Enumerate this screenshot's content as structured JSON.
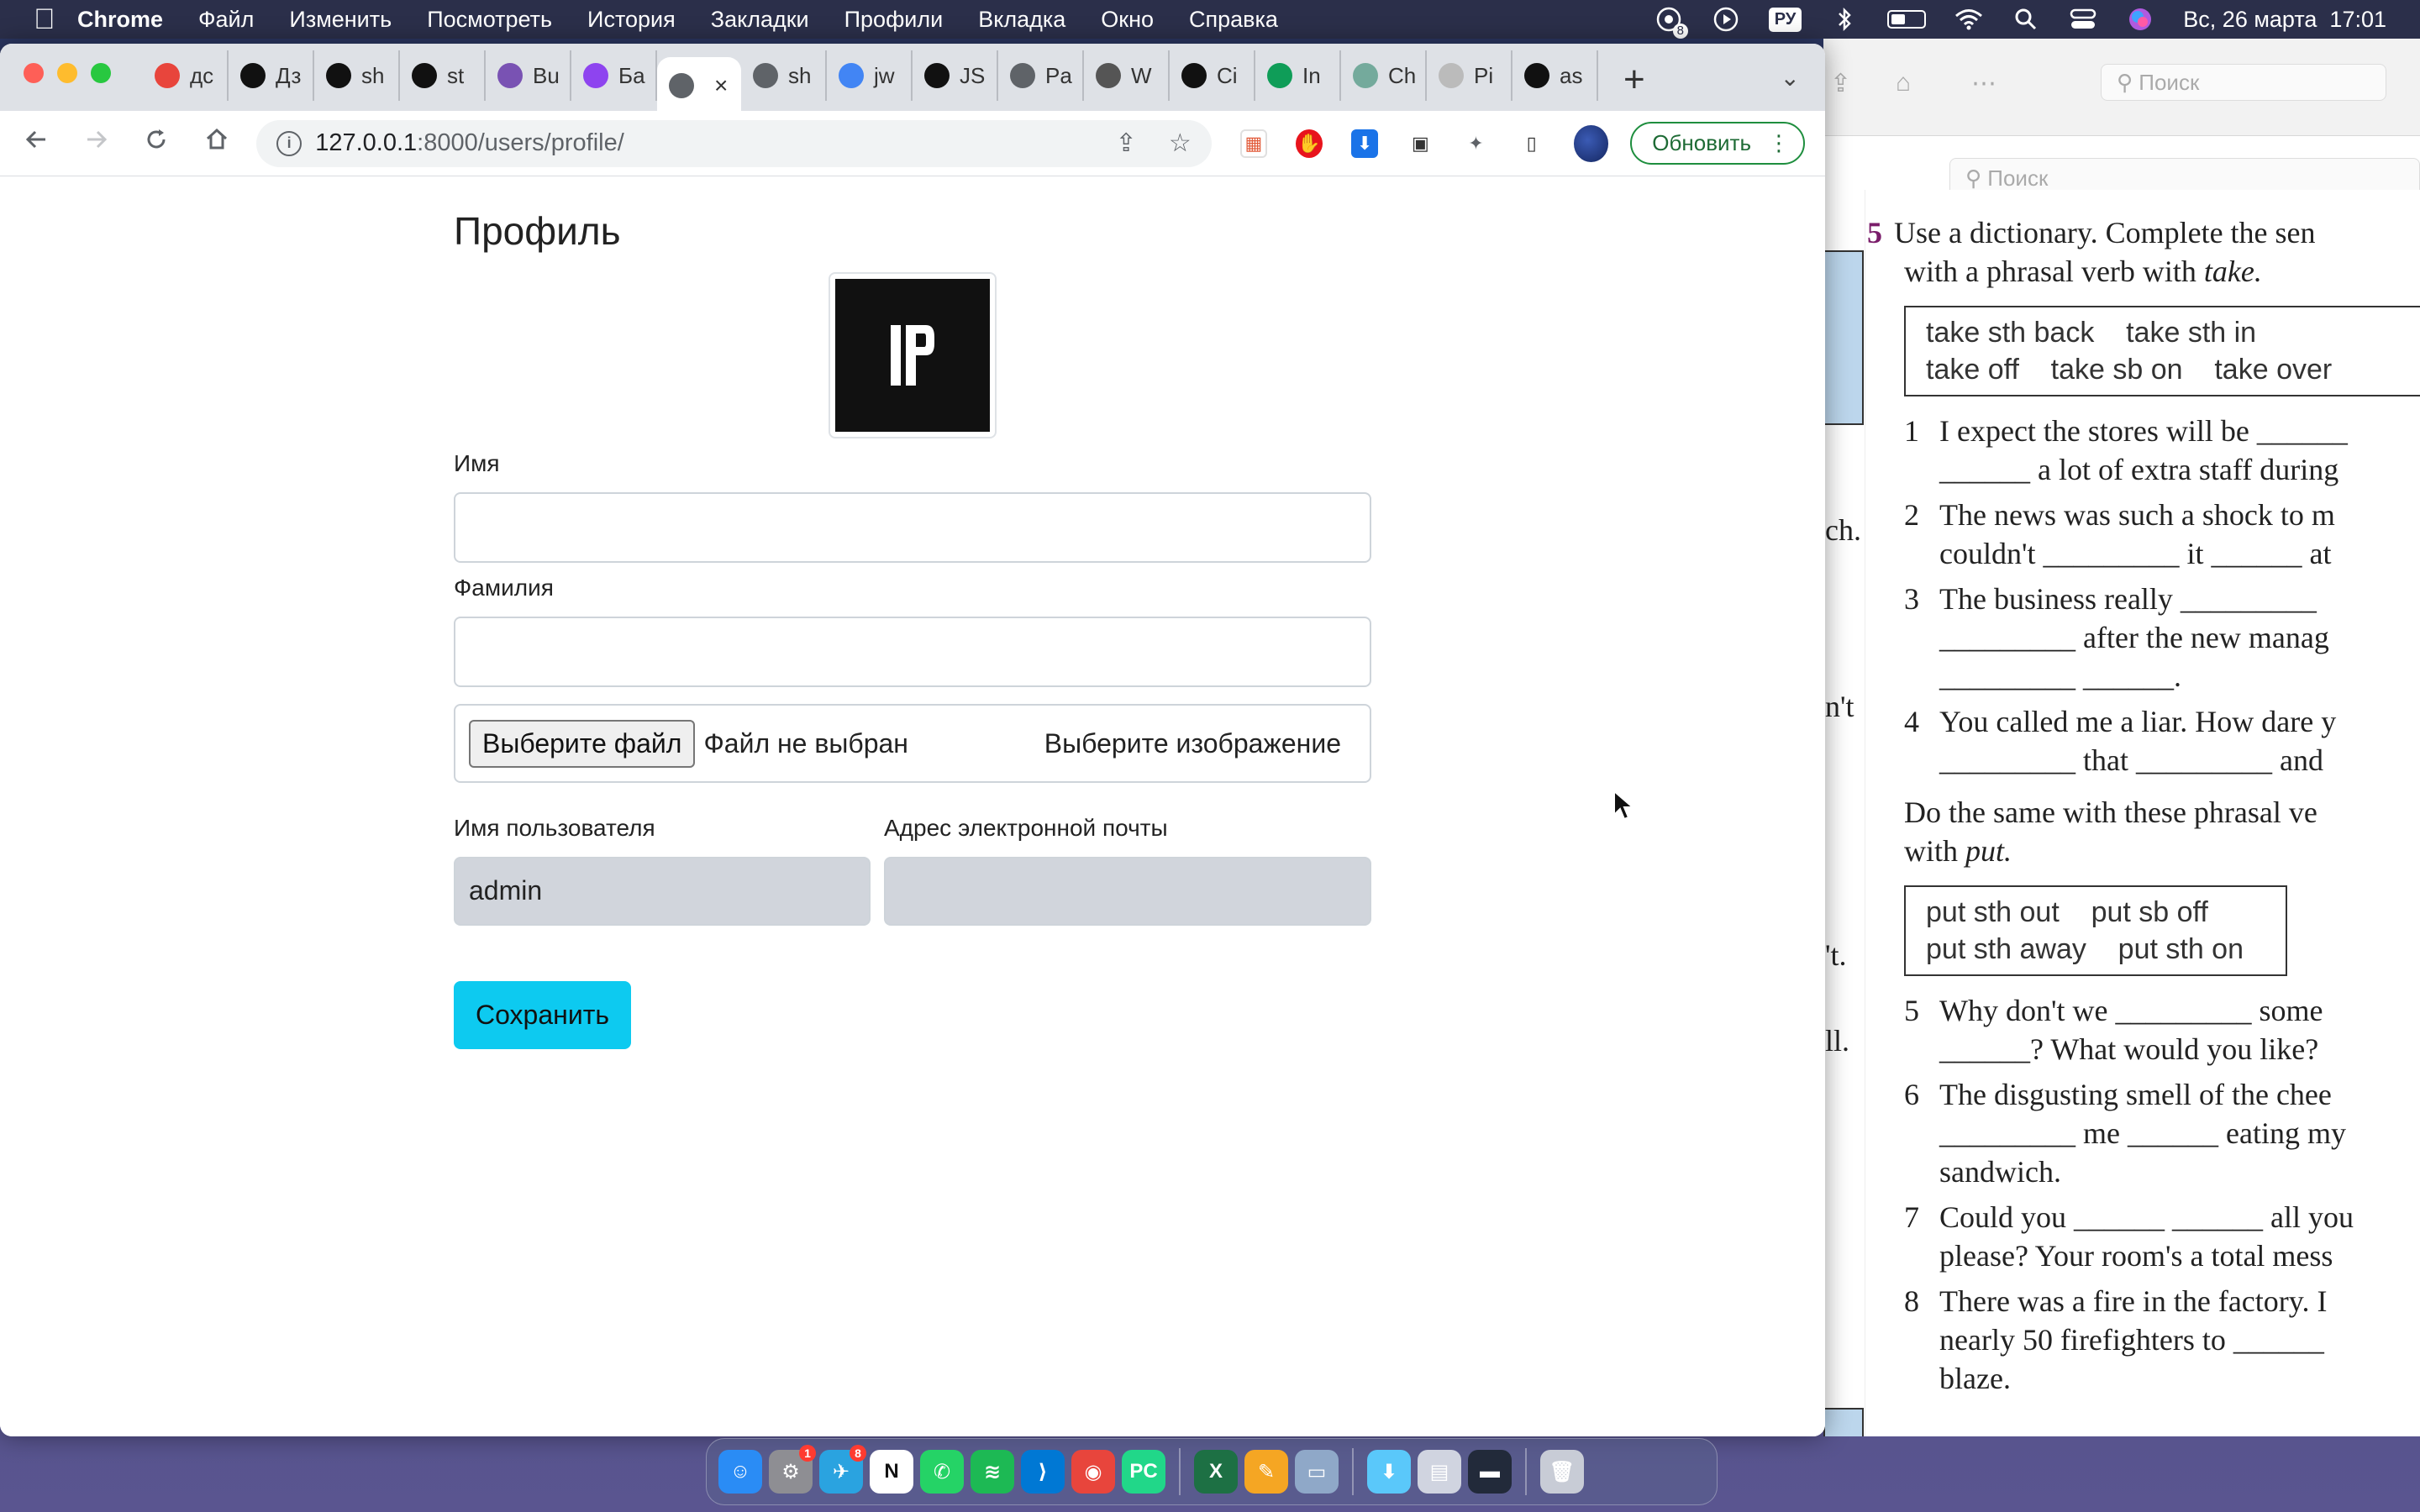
{
  "menubar": {
    "app_name": "Chrome",
    "items": [
      "Файл",
      "Изменить",
      "Посмотреть",
      "История",
      "Закладки",
      "Профили",
      "Вкладка",
      "Окно",
      "Справка"
    ],
    "input_lang": "РУ",
    "clock": "Вс, 26 марта  17:01",
    "notification_count": "8"
  },
  "browser": {
    "tabs": [
      {
        "title": "дс",
        "icon": "translate-icon",
        "color": "#e8453c"
      },
      {
        "title": "Дз",
        "icon": "openai-icon",
        "color": "#111111"
      },
      {
        "title": "sh",
        "icon": "github-icon",
        "color": "#111111"
      },
      {
        "title": "st",
        "icon": "github-icon",
        "color": "#111111"
      },
      {
        "title": "Bu",
        "icon": "bootstrap-icon",
        "color": "#7952b3"
      },
      {
        "title": "Ба",
        "icon": "purple-globe-icon",
        "color": "#8e44ef"
      },
      {
        "title": "",
        "icon": "globe-icon",
        "color": "#5f6368",
        "active": true
      },
      {
        "title": "sh",
        "icon": "globe-icon",
        "color": "#5f6368"
      },
      {
        "title": "jw",
        "icon": "google-icon",
        "color": "#4285f4"
      },
      {
        "title": "JS",
        "icon": "js-icon",
        "color": "#111111"
      },
      {
        "title": "Pa",
        "icon": "globe-icon",
        "color": "#5f6368"
      },
      {
        "title": "W",
        "icon": "book-icon",
        "color": "#555555"
      },
      {
        "title": "Ci",
        "icon": "hd-icon",
        "color": "#111111"
      },
      {
        "title": "In",
        "icon": "plus-green-icon",
        "color": "#0f9d58"
      },
      {
        "title": "Ch",
        "icon": "chatgpt-icon",
        "color": "#74aa9c"
      },
      {
        "title": "Pi",
        "icon": "cube-icon",
        "color": "#bbbbbb"
      },
      {
        "title": "as",
        "icon": "github-icon",
        "color": "#111111"
      }
    ],
    "url_host": "127.0.0.1",
    "url_path": ":8000/users/profile/",
    "update_label": "Обновить"
  },
  "profile": {
    "title": "Профиль",
    "first_name_label": "Имя",
    "first_name_value": "",
    "last_name_label": "Фамилия",
    "last_name_value": "",
    "file_button": "Выберите файл",
    "file_status": "Файл не выбран",
    "file_hint": "Выберите изображение",
    "username_label": "Имя пользователя",
    "username_value": "admin",
    "email_label": "Адрес электронной почты",
    "email_value": "",
    "save_label": "Сохранить"
  },
  "background_app": {
    "search1": "Поиск",
    "search2": "Поиск",
    "margin_texts": [
      "ch.",
      "n't",
      "'t.",
      "ll."
    ],
    "exercise_num": "5",
    "intro_1": "Use a dictionary. Complete the sen",
    "intro_2": "with a phrasal verb with ",
    "intro_2_em": "take.",
    "box1_line1": "take sth back    take sth in",
    "box1_line2": "take off    take sb on    take over",
    "items": [
      {
        "n": "1",
        "l1": "I expect the stores will be ______",
        "l2": "______ a lot of extra staff during"
      },
      {
        "n": "2",
        "l1": "The news was such a shock to m",
        "l2": "couldn't _________ it ______ at"
      },
      {
        "n": "3",
        "l1": "The business really _________",
        "l2": "_________ after the new manag",
        "l3": "_________ ______."
      },
      {
        "n": "4",
        "l1": "You called me a liar. How dare y",
        "l2": "_________ that _________ and"
      }
    ],
    "para2_1": "Do the same with these phrasal ve",
    "para2_2": "with ",
    "para2_2_em": "put.",
    "box2_line1": "put sth out    put sb off",
    "box2_line2": "put sth away    put sth on",
    "items2": [
      {
        "n": "5",
        "l1": "Why don't we _________ some",
        "l2": "______? What would you like?"
      },
      {
        "n": "6",
        "l1": "The disgusting smell of the chee",
        "l2": "_________ me ______ eating my",
        "l3": "sandwich."
      },
      {
        "n": "7",
        "l1": "Could you ______ ______ all you",
        "l2": "please? Your room's a total mess"
      },
      {
        "n": "8",
        "l1": "There was a fire in the factory. I",
        "l2": "nearly 50 firefighters to ______",
        "l3": "blaze."
      }
    ]
  },
  "dock": {
    "apps": [
      {
        "name": "finder-icon",
        "color": "#2a8cf5",
        "label": "☺"
      },
      {
        "name": "system-settings-icon",
        "color": "#8e8e93",
        "label": "⚙",
        "badge": "1"
      },
      {
        "name": "telegram-icon",
        "color": "#2aa3e0",
        "label": "✈",
        "badge": "8"
      },
      {
        "name": "notion-icon",
        "color": "#ffffff",
        "label": "N"
      },
      {
        "name": "whatsapp-icon",
        "color": "#25d366",
        "label": "✆"
      },
      {
        "name": "spotify-icon",
        "color": "#1db954",
        "label": "≋"
      },
      {
        "name": "vscode-icon",
        "color": "#0078d4",
        "label": "⟩"
      },
      {
        "name": "chrome-icon",
        "color": "#e8453c",
        "label": "◉"
      },
      {
        "name": "pycharm-icon",
        "color": "#21d789",
        "label": "PC"
      },
      {
        "name": "excel-icon",
        "color": "#1d7044",
        "label": "X"
      },
      {
        "name": "pages-icon",
        "color": "#f5a623",
        "label": "✎"
      },
      {
        "name": "preview-icon",
        "color": "#8fa8c8",
        "label": "▭"
      },
      {
        "name": "downloads-folder-icon",
        "color": "#5ac8fa",
        "label": "⬇"
      },
      {
        "name": "document-stack-icon",
        "color": "#d0d4e0",
        "label": "▤"
      },
      {
        "name": "window-thumbnail-icon",
        "color": "#222a3a",
        "label": "▬"
      },
      {
        "name": "trash-icon",
        "color": "#c8ccd6",
        "label": "🗑"
      }
    ]
  }
}
